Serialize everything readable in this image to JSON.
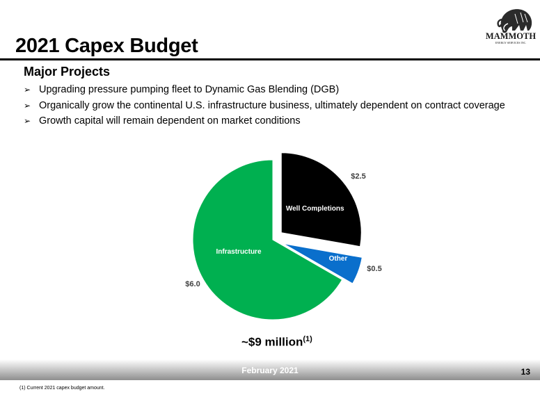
{
  "slide": {
    "title": "2021 Capex Budget",
    "logo_text": "MAMMOTH",
    "logo_subtext": "ENERGY SERVICES INC.",
    "section_heading": "Major Projects",
    "bullets": [
      "Upgrading pressure pumping fleet to Dynamic Gas Blending (DGB)",
      "Organically grow the continental U.S. infrastructure business, ultimately dependent on contract coverage",
      "Growth capital will remain dependent on market conditions"
    ],
    "bullet_marker": "➢",
    "total_label": "~$9 million",
    "total_footnote_ref": "(1)",
    "footer_date": "February 2021",
    "page_number": "13",
    "footnote": "(1) Current 2021 capex budget amount."
  },
  "chart_data": {
    "type": "pie",
    "title": "",
    "units": "$ millions",
    "slices": [
      {
        "label": "Well Completions",
        "value": 2.5,
        "value_label": "$2.5",
        "color": "#000000",
        "label_color": "#ffffff",
        "exploded": true
      },
      {
        "label": "Other",
        "value": 0.5,
        "value_label": "$0.5",
        "color": "#0a6fcc",
        "label_color": "#ffffff",
        "exploded": true
      },
      {
        "label": "Infrastructure",
        "value": 6.0,
        "value_label": "$6.0",
        "color": "#00b050",
        "label_color": "#ffffff",
        "exploded": false
      }
    ]
  }
}
